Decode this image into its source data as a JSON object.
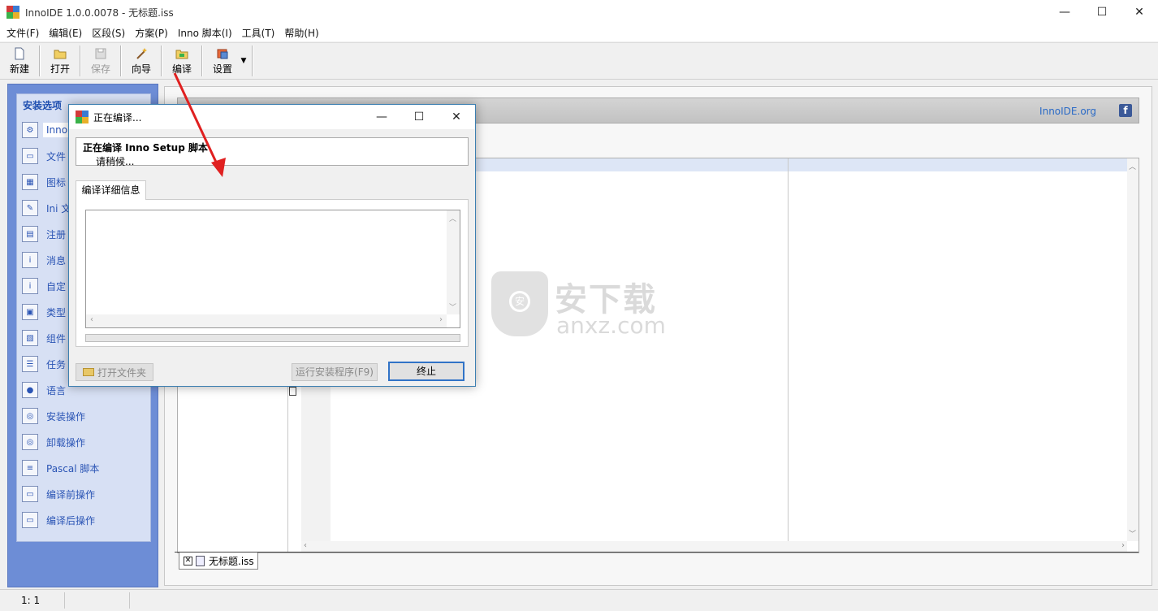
{
  "window": {
    "title": "InnoIDE 1.0.0.0078 - 无标题.iss",
    "minimize": "—",
    "maximize": "☐",
    "close": "✕"
  },
  "menu": [
    "文件(F)",
    "编辑(E)",
    "区段(S)",
    "方案(P)",
    "Inno 脚本(I)",
    "工具(T)",
    "帮助(H)"
  ],
  "toolbar": {
    "new": "新建",
    "open": "打开",
    "save": "保存",
    "wizard": "向导",
    "compile": "编译",
    "settings": "设置"
  },
  "sidebar": {
    "header": "安装选项",
    "items": [
      "Inno",
      "文件",
      "图标",
      "Ini 文",
      "注册",
      "消息",
      "自定",
      "类型",
      "组件",
      "任务",
      "语言",
      "安装操作",
      "卸载操作",
      "Pascal 脚本",
      "编译前操作",
      "编译后操作"
    ]
  },
  "banner": {
    "site": "InnoIDE.org",
    "fb": "f"
  },
  "doc_tab": "无标题.iss",
  "watermark": {
    "cn": "安下载",
    "en": "anxz.com",
    "badge": "安"
  },
  "status": {
    "position": "1:   1"
  },
  "dialog": {
    "title": "正在编译...",
    "heading": "正在编译 Inno Setup 脚本",
    "sub": "请稍候...",
    "tab": "编译详细信息",
    "progress": 0,
    "btn_open_folder": "打开文件夹",
    "btn_run": "运行安装程序(F9)",
    "btn_stop": "终止"
  },
  "colors": {
    "sidebar_bg": "#6d8dd6",
    "accent": "#3173c7",
    "arrow": "#e02020"
  }
}
